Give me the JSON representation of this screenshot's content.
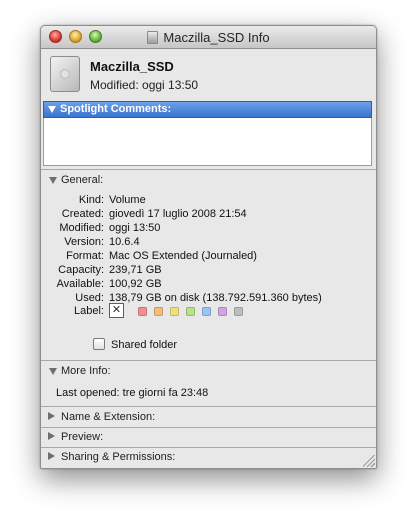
{
  "window": {
    "title": "Maczilla_SSD Info"
  },
  "header": {
    "name": "Maczilla_SSD",
    "modified": "Modified: oggi 13:50"
  },
  "spotlight": {
    "label": "Spotlight Comments:",
    "comment": ""
  },
  "general": {
    "label": "General:",
    "rows": [
      {
        "label": "Kind:",
        "value": "Volume"
      },
      {
        "label": "Created:",
        "value": "giovedì 17 luglio 2008 21:54"
      },
      {
        "label": "Modified:",
        "value": "oggi 13:50"
      },
      {
        "label": "Version:",
        "value": "10.6.4"
      },
      {
        "label": "Format:",
        "value": "Mac OS Extended (Journaled)"
      },
      {
        "label": "Capacity:",
        "value": "239,71 GB"
      },
      {
        "label": "Available:",
        "value": "100,92 GB"
      },
      {
        "label": "Used:",
        "value": "138,79 GB on disk (138.792.591.360 bytes)"
      }
    ],
    "label_field": "Label:",
    "label_none_glyph": "✕",
    "label_colors": [
      "#f08f8f",
      "#f2bf7a",
      "#efe07a",
      "#b8e28a",
      "#9cc4f2",
      "#d2a4e6",
      "#bdbdbd"
    ],
    "shared_folder": {
      "label": "Shared folder",
      "checked": false
    }
  },
  "more_info": {
    "label": "More Info:",
    "last_opened": "Last opened: tre giorni fa 23:48"
  },
  "collapsed_sections": [
    "Name & Extension:",
    "Preview:",
    "Sharing & Permissions:"
  ]
}
